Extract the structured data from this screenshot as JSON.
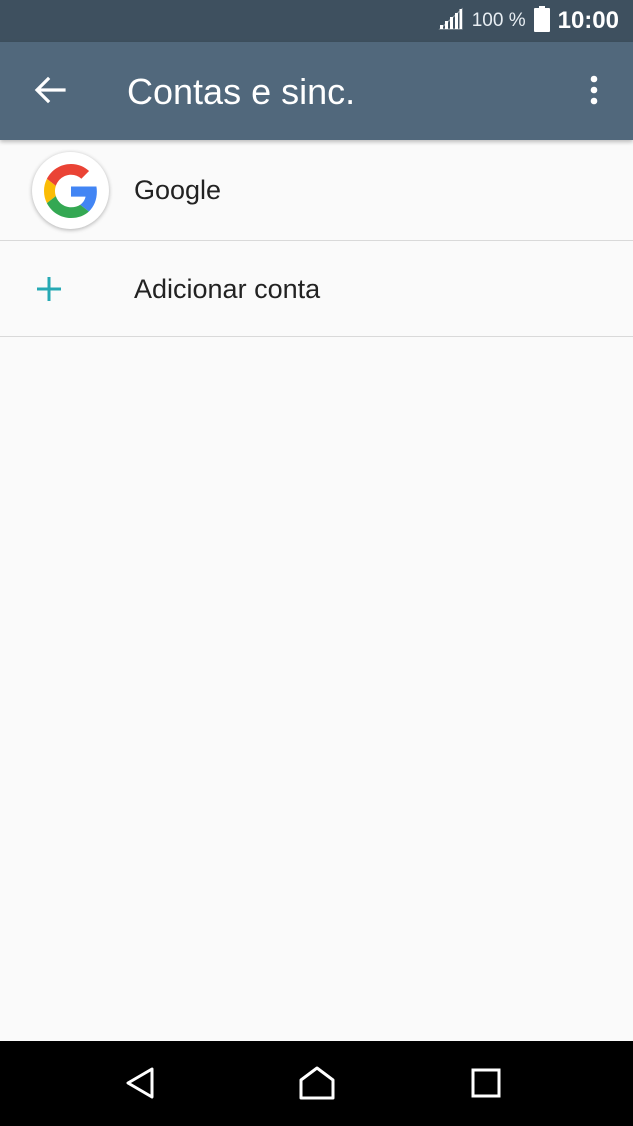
{
  "status_bar": {
    "battery_percent": "100 %",
    "time": "10:00",
    "icons": [
      "signal-icon",
      "battery-icon"
    ]
  },
  "app_bar": {
    "title": "Contas e sinc.",
    "icons": [
      "back-arrow-icon",
      "overflow-menu-icon"
    ]
  },
  "accounts": {
    "items": [
      {
        "label": "Google",
        "icon": "google-logo-icon"
      },
      {
        "label": "Adicionar conta",
        "icon": "plus-icon"
      }
    ]
  },
  "nav_bar": {
    "icons": [
      "back-triangle-icon",
      "home-icon",
      "recents-square-icon"
    ]
  },
  "colors": {
    "status_bar": "#3e505f",
    "app_bar": "#51687c",
    "background": "#fafafa",
    "accent": "#26a9b4"
  }
}
